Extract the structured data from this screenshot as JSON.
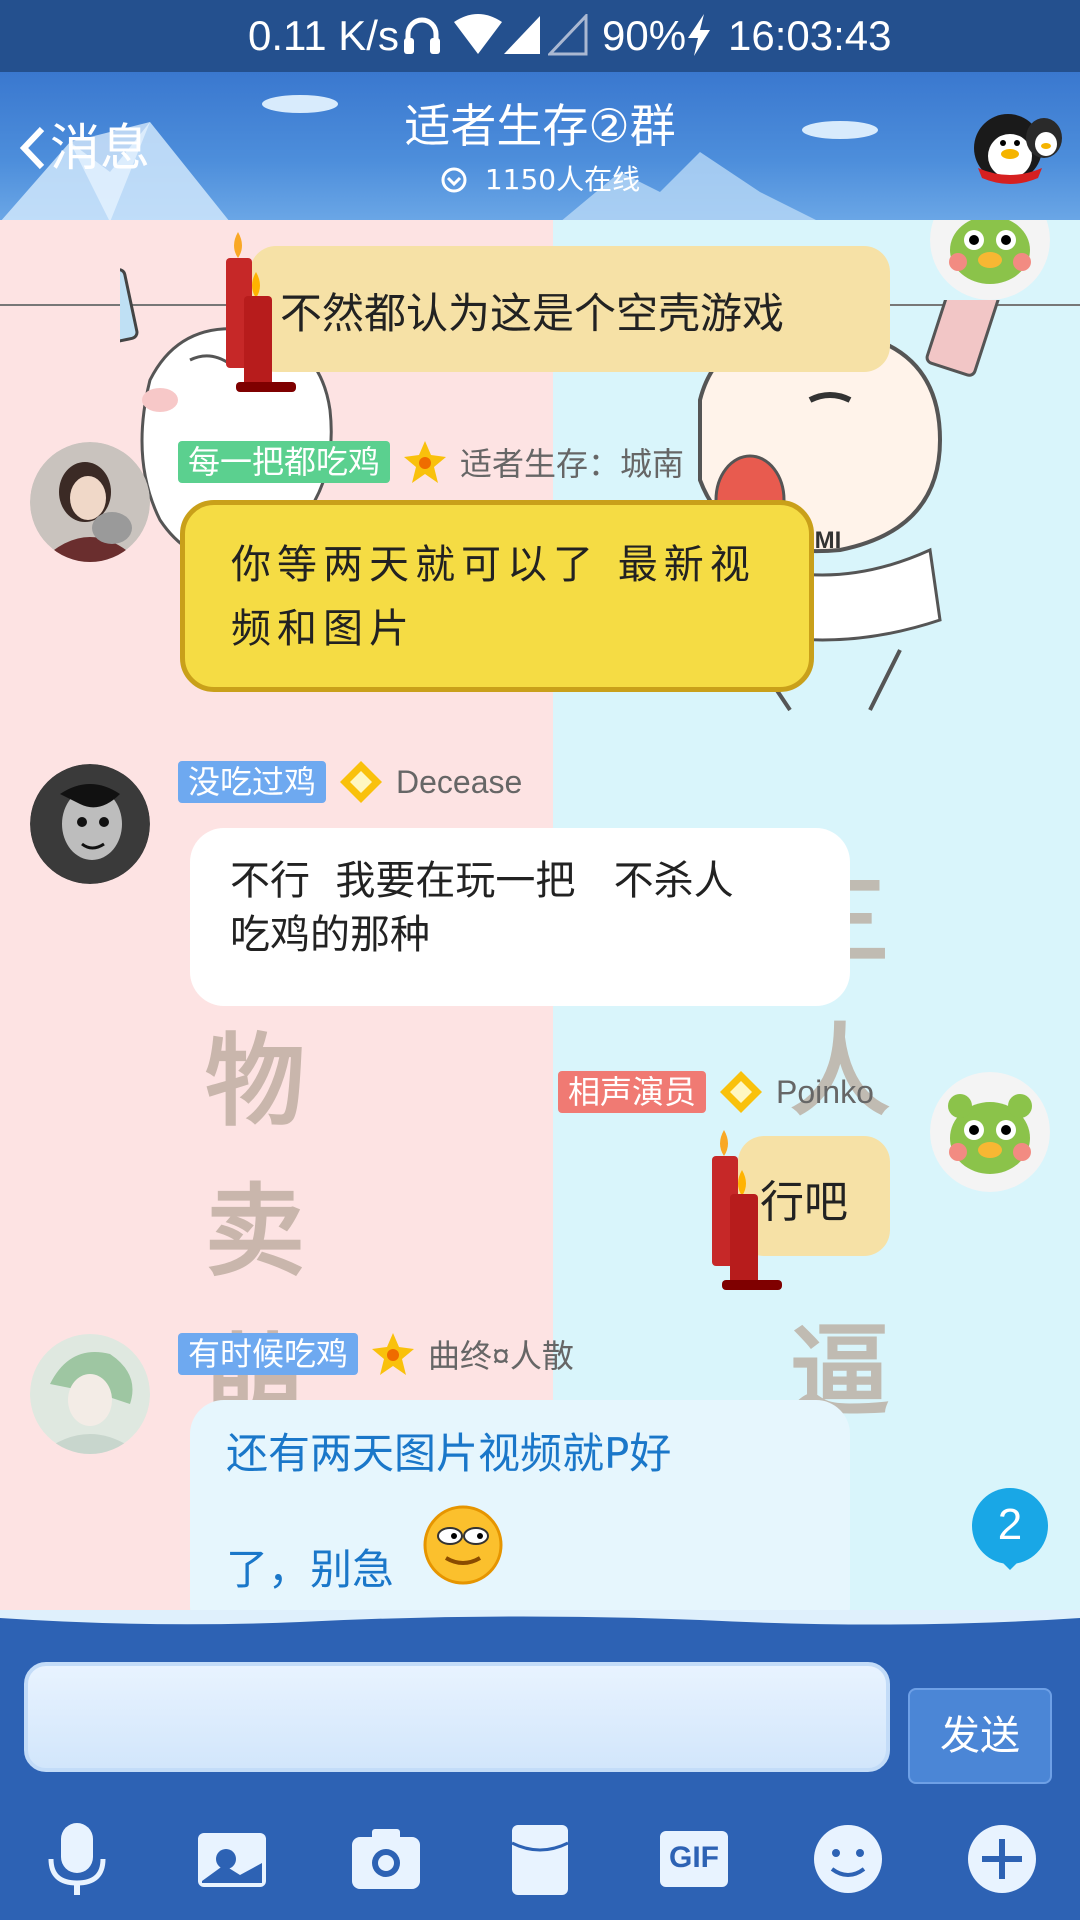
{
  "status_bar": {
    "speed": "0.11 K/s",
    "battery": "90%",
    "time": "16:03:43",
    "icons": [
      "headphones-icon",
      "wifi-icon",
      "signal-icon",
      "signal-empty-icon",
      "charging-icon"
    ]
  },
  "header": {
    "back_label": "消息",
    "title": "适者生存②群",
    "online": "1150人在线"
  },
  "background_art": {
    "left_chars": [
      "物",
      "卖",
      "萌"
    ],
    "right_chars": [
      "三",
      "人",
      "逼"
    ],
    "shirt_text": "RAMI"
  },
  "messages": [
    {
      "sender": "self",
      "text": "不然都认为这是个空壳游戏"
    },
    {
      "sender": "other",
      "tag": "每一把都吃鸡",
      "tag_color": "#5bd08f",
      "nick": "适者生存：城南",
      "text": "你等两天就可以了 最新视频和图片"
    },
    {
      "sender": "other",
      "tag": "没吃过鸡",
      "tag_color": "#6ea9f0",
      "nick": "Decease",
      "text_line1": "不行  我要在玩一把   不杀人",
      "text_line2": "吃鸡的那种"
    },
    {
      "sender": "self",
      "tag": "相声演员",
      "tag_color": "#f07a73",
      "nick": "Poinko",
      "text": "行吧"
    },
    {
      "sender": "other",
      "tag": "有时候吃鸡",
      "tag_color": "#6ea9f0",
      "nick": "曲终¤人散",
      "text_line1": "还有两天图片视频就P好",
      "text_line2": "了，别急"
    }
  ],
  "unread_badge": "2",
  "input": {
    "placeholder": "",
    "send_label": "发送"
  },
  "toolbar": {
    "items": [
      "microphone-icon",
      "photo-icon",
      "camera-icon",
      "red-packet-icon",
      "gif-icon",
      "emoji-icon",
      "plus-icon"
    ],
    "gif_label": "GIF"
  },
  "colors": {
    "header_blue": "#3a78cf",
    "status_bar": "#24508e",
    "link_blue": "#1a77c9",
    "candle_bubble": "#f6e1a6",
    "yellow_bubble": "#f5dc44"
  }
}
